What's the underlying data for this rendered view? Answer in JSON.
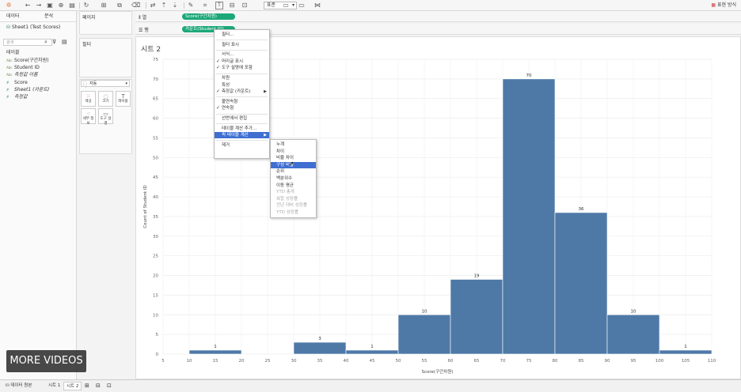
{
  "toolbar": {
    "fit_value": "표준",
    "show_me_label": "표현 방식"
  },
  "left_pane": {
    "tab_data": "데이터",
    "tab_analytics": "분석",
    "datasource": "Sheet1 (Test Scores)",
    "search_placeholder": "검색",
    "section_label": "테이블",
    "fields": [
      {
        "label": "Score(구간차원)",
        "kind": "dimension"
      },
      {
        "label": "Student ID",
        "kind": "dimension"
      },
      {
        "label": "측정값 이름",
        "kind": "dimension",
        "italic": true
      },
      {
        "label": "Score",
        "kind": "measure"
      },
      {
        "label": "Sheet1 (카운트)",
        "kind": "measure",
        "italic": true
      },
      {
        "label": "측정값",
        "kind": "measure",
        "italic": true
      }
    ]
  },
  "cards": {
    "pages_label": "페이지",
    "filters_label": "필터",
    "marks_label": "마크",
    "marks_type": "자동",
    "mark_buttons": [
      {
        "label": "색상",
        "icon": "color-icon"
      },
      {
        "label": "크기",
        "icon": "size-icon"
      },
      {
        "label": "레이블",
        "icon": "label-icon"
      },
      {
        "label": "세부 정보",
        "icon": "detail-icon"
      },
      {
        "label": "도구 설명",
        "icon": "tooltip-icon"
      }
    ]
  },
  "shelves": {
    "columns_label": "열",
    "rows_label": "행",
    "columns_pill": "Score(구간차원)",
    "rows_pill": "카운트(Student ID)"
  },
  "sheet": {
    "title": "시트 2"
  },
  "context_menu": {
    "items": [
      {
        "label": "필터...",
        "check": false
      },
      {
        "label": "필터 표시",
        "check": false
      },
      {
        "label": "서식...",
        "check": false
      },
      {
        "label": "머리글 표시",
        "check": true
      },
      {
        "label": "도구 설명에 포함",
        "check": true
      },
      {
        "label": "차원",
        "check": false
      },
      {
        "label": "특성",
        "check": false
      },
      {
        "label": "측정값 (카운트)",
        "check": true,
        "submenu": true
      },
      {
        "label": "불연속형",
        "check": false
      },
      {
        "label": "연속형",
        "check": true
      },
      {
        "label": "선반에서 편집",
        "check": false
      },
      {
        "label": "테이블 계산 추가...",
        "check": false
      },
      {
        "label": "퀵 테이블 계산",
        "check": false,
        "submenu": true,
        "selected": true
      },
      {
        "label": "제거",
        "check": false
      }
    ],
    "submenu": [
      {
        "label": "누계",
        "disabled": false
      },
      {
        "label": "차이",
        "disabled": false
      },
      {
        "label": "비율 차이",
        "disabled": false
      },
      {
        "label": "구성 비율",
        "disabled": false,
        "selected": true
      },
      {
        "label": "순위",
        "disabled": false
      },
      {
        "label": "백분위수",
        "disabled": false
      },
      {
        "label": "이동 평균",
        "disabled": false
      },
      {
        "label": "YTD 총계",
        "disabled": true
      },
      {
        "label": "복합 성장률",
        "disabled": true
      },
      {
        "label": "전년 대비 성장률",
        "disabled": true
      },
      {
        "label": "YTD 성장률",
        "disabled": true
      }
    ]
  },
  "chart_data": {
    "type": "bar",
    "title": "",
    "xlabel": "Score(구간차원)",
    "ylabel": "Count of Student ID",
    "bin_width": 10,
    "bins": [
      {
        "start": 10,
        "count": 1
      },
      {
        "start": 30,
        "count": 3
      },
      {
        "start": 40,
        "count": 1
      },
      {
        "start": 50,
        "count": 10
      },
      {
        "start": 60,
        "count": 19
      },
      {
        "start": 70,
        "count": 70
      },
      {
        "start": 80,
        "count": 36
      },
      {
        "start": 90,
        "count": 10
      },
      {
        "start": 100,
        "count": 1
      }
    ],
    "xlim": [
      5,
      110
    ],
    "xticks": [
      5,
      10,
      15,
      20,
      25,
      30,
      35,
      40,
      45,
      50,
      55,
      60,
      65,
      70,
      75,
      80,
      85,
      90,
      95,
      100,
      105,
      110
    ],
    "ylim": [
      0,
      75
    ],
    "yticks": [
      0,
      5,
      10,
      15,
      20,
      25,
      30,
      35,
      40,
      45,
      50,
      55,
      60,
      65,
      70,
      75
    ],
    "bar_color": "#4e79a7",
    "grid": true
  },
  "bottom": {
    "datasource_tab": "데이터 원본",
    "sheet_tabs": [
      "시트 1",
      "시트 2"
    ]
  },
  "overlay": {
    "more_videos": "MORE VIDEOS"
  }
}
